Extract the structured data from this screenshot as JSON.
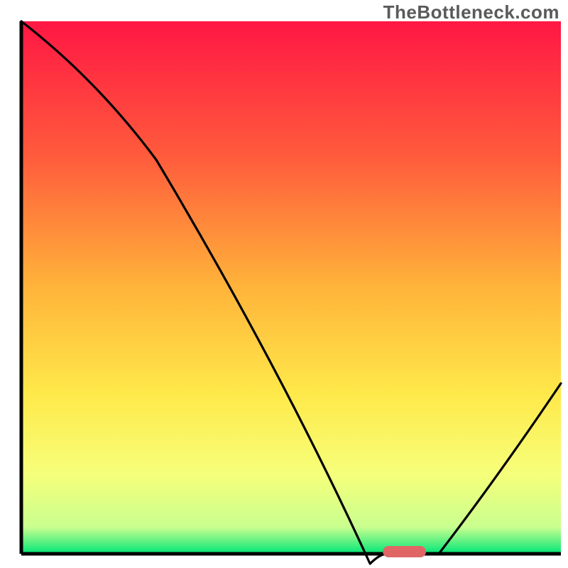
{
  "watermark": "TheBottleneck.com",
  "chart_data": {
    "type": "line",
    "title": "",
    "xlabel": "",
    "ylabel": "",
    "xlim": [
      0,
      100
    ],
    "ylim": [
      0,
      100
    ],
    "x": [
      0,
      25,
      67,
      75,
      100
    ],
    "values": [
      100,
      74,
      0,
      0,
      32
    ],
    "min_marker": {
      "x_start": 67,
      "x_end": 75,
      "color": "#e06666"
    },
    "gradient_stops": [
      {
        "offset": 0,
        "color": "#ff1744"
      },
      {
        "offset": 25,
        "color": "#ff5a3c"
      },
      {
        "offset": 50,
        "color": "#ffb43a"
      },
      {
        "offset": 70,
        "color": "#ffe94a"
      },
      {
        "offset": 85,
        "color": "#f6ff7a"
      },
      {
        "offset": 95,
        "color": "#c9ff8f"
      },
      {
        "offset": 100,
        "color": "#00e676"
      }
    ],
    "curve_note": "V-shaped bottleneck curve; minimum plateau around x≈67–75; left arm has slight knee near x≈25."
  }
}
